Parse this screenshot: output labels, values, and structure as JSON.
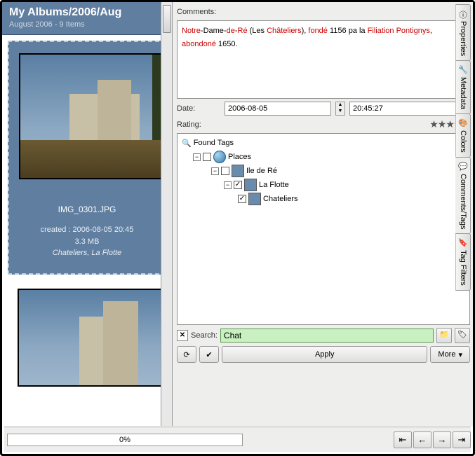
{
  "album": {
    "title": "My Albums/2006/Aug",
    "subtitle": "August 2006 - 9 Items"
  },
  "selected": {
    "filename": "IMG_0301.JPG",
    "created_label": "created : 2006-08-05 20:45",
    "size": "3.3 MB",
    "tags_line": "Chateliers, La Flotte"
  },
  "comments": {
    "label": "Comments:",
    "parts": {
      "p1": "Notre",
      "p2": "-Dame-",
      "p3": "de",
      "p4": "-",
      "p5": "Ré",
      "p6": " (Les ",
      "p7": "Châteliers",
      "p8": "), ",
      "p9": "fondé",
      "p10": " 1156 pa la ",
      "p11": "Filiation Pontignys",
      "p12": ", ",
      "p13": "abondoné",
      "p14": " 1650."
    }
  },
  "date": {
    "label": "Date:",
    "value": "2006-08-05",
    "time": "20:45:27"
  },
  "rating": {
    "label": "Rating:"
  },
  "tags": {
    "root": "Found Tags",
    "places": "Places",
    "ile": "Ile de Ré",
    "flotte": "La Flotte",
    "chat": "Chateliers"
  },
  "search": {
    "label": "Search:",
    "value": "Chat"
  },
  "buttons": {
    "apply": "Apply",
    "more": "More"
  },
  "tabs": {
    "properties": "Properties",
    "metadata": "Metadata",
    "colors": "Colors",
    "comments": "Comments/Tags",
    "filters": "Tag Filters"
  },
  "progress": "0%"
}
